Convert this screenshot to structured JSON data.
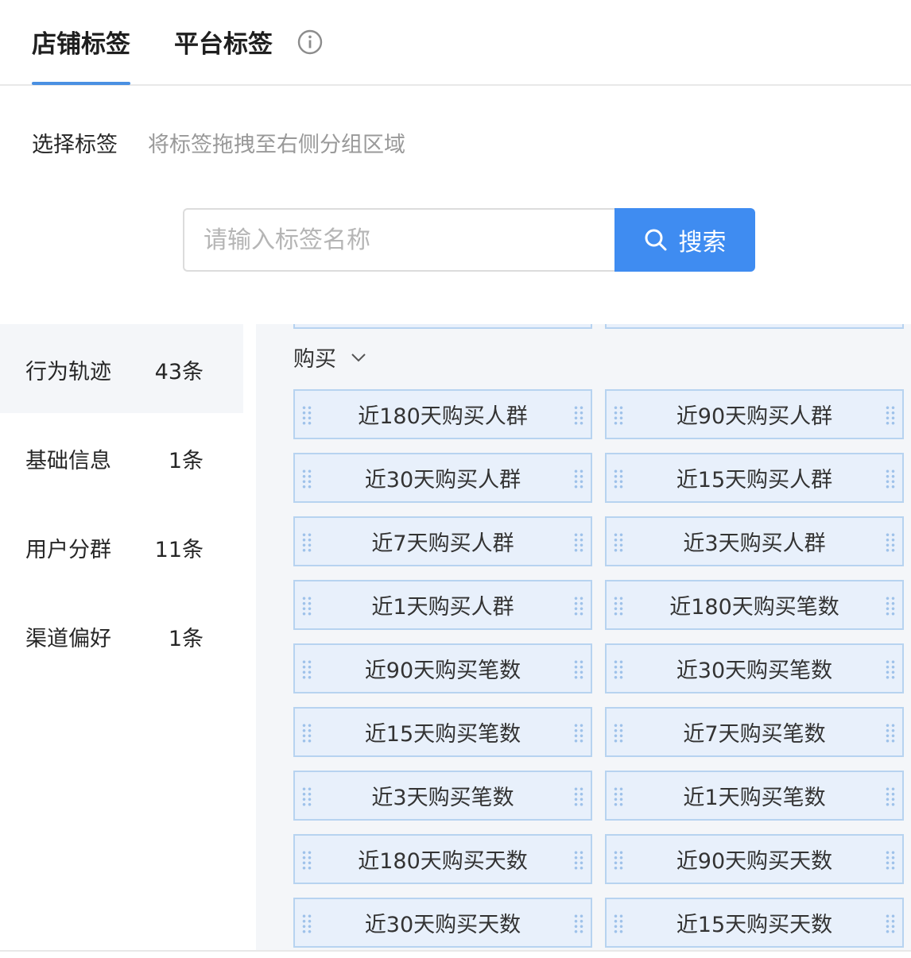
{
  "tabs": {
    "store": "店铺标签",
    "platform": "平台标签"
  },
  "select": {
    "label": "选择标签",
    "hint": "将标签拖拽至右侧分组区域"
  },
  "search": {
    "placeholder": "请输入标签名称",
    "button_label": "搜索"
  },
  "sidebar": {
    "items": [
      {
        "name": "行为轨迹",
        "count": "43条"
      },
      {
        "name": "基础信息",
        "count": "1条"
      },
      {
        "name": "用户分群",
        "count": "11条"
      },
      {
        "name": "渠道偏好",
        "count": "1条"
      }
    ]
  },
  "group": {
    "title": "购买",
    "tags": [
      "近180天购买人群",
      "近90天购买人群",
      "近30天购买人群",
      "近15天购买人群",
      "近7天购买人群",
      "近3天购买人群",
      "近1天购买人群",
      "近180天购买笔数",
      "近90天购买笔数",
      "近30天购买笔数",
      "近15天购买笔数",
      "近7天购买笔数",
      "近3天购买笔数",
      "近1天购买笔数",
      "近180天购买天数",
      "近90天购买天数",
      "近30天购买天数",
      "近15天购买天数"
    ]
  },
  "icons": [
    "info-icon",
    "search-icon",
    "chevron-down-icon",
    "drag-handle-icon"
  ],
  "colors": {
    "accent": "#3f8cf1",
    "tag_bg": "#e8f0fb",
    "tag_border": "#b7d3f0",
    "panel_bg": "#f4f6f9"
  }
}
